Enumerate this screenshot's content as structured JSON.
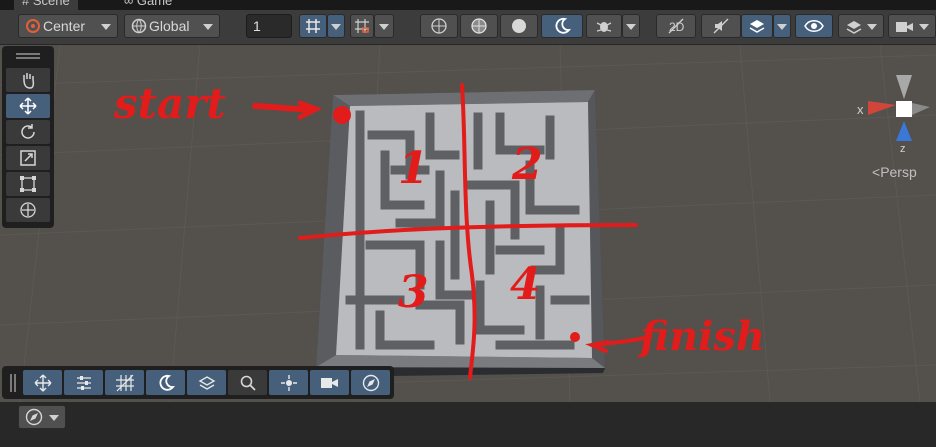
{
  "tabs": [
    {
      "label": "# Scene"
    },
    {
      "label": "∞ Game"
    }
  ],
  "toolbar": {
    "pivot_label": "Center",
    "space_label": "Global",
    "grid_value": "1"
  },
  "tools": {
    "items": [
      "hand",
      "move",
      "rotate",
      "scale",
      "rect",
      "transform"
    ]
  },
  "gizmo": {
    "x_label": "x",
    "z_label": "z",
    "persp_label": "Persp"
  },
  "annotations": {
    "start": "start",
    "finish": "finish",
    "q1": "1",
    "q2": "2",
    "q3": "3",
    "q4": "4"
  },
  "colors": {
    "annotation": "#e21b1b",
    "active": "#46607c",
    "viewport": "#54504c"
  }
}
